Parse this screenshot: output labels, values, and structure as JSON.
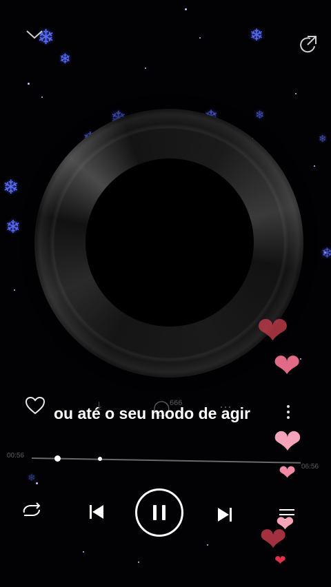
{
  "player": {
    "lyric": "ou até o seu modo de agir",
    "current_time": "00:56",
    "total_time": "06:56",
    "progress": 0.08,
    "comment_count": "666"
  },
  "colors": {
    "background": "#020204",
    "snowflake": "#5a6df0",
    "heart_red": "#c0394a",
    "heart_pink": "#f5a3b8"
  },
  "icons": {
    "collapse": "chevron-down-icon",
    "share": "share-icon",
    "like": "heart-outline-icon",
    "more": "more-vertical-icon",
    "repeat": "repeat-icon",
    "previous": "skip-previous-icon",
    "play_pause": "pause-icon",
    "next": "skip-next-icon",
    "playlist": "playlist-icon"
  }
}
